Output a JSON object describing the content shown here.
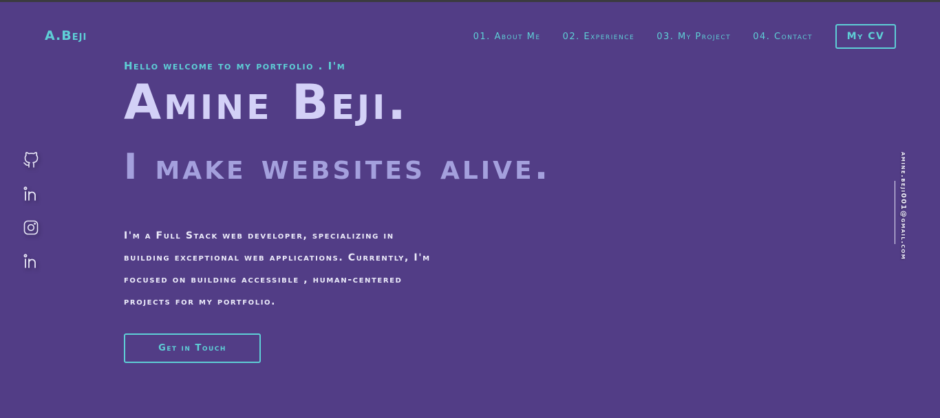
{
  "brand": {
    "logo": "A.Beji"
  },
  "nav": {
    "items": [
      {
        "number": "01.",
        "label": "About Me"
      },
      {
        "number": "02.",
        "label": "Experience"
      },
      {
        "number": "03.",
        "label": "My Project"
      },
      {
        "number": "04.",
        "label": "Contact"
      }
    ],
    "cv_button": "My CV"
  },
  "hero": {
    "greeting": "Hello welcome to my portfolio . I'm",
    "name": "Amine Beji.",
    "tagline": "I make websites alive.",
    "bio_lines": [
      " I'm a Full Stack web developer, specializing  in",
      "building exceptional web applications.  Currently, I'm",
      " focused on building accessible , human-centered",
      "projects for my portfolio."
    ],
    "cta": "Get in Touch"
  },
  "social": {
    "icons": [
      "github-icon",
      "linkedin-icon",
      "instagram-icon",
      "linkedin-icon"
    ]
  },
  "contact": {
    "email": "amine.beji001@gmail.com"
  },
  "colors": {
    "background": "#523d86",
    "accent": "#5ecfd6",
    "name": "#d3d1f7",
    "tagline": "#a4a0dd"
  }
}
